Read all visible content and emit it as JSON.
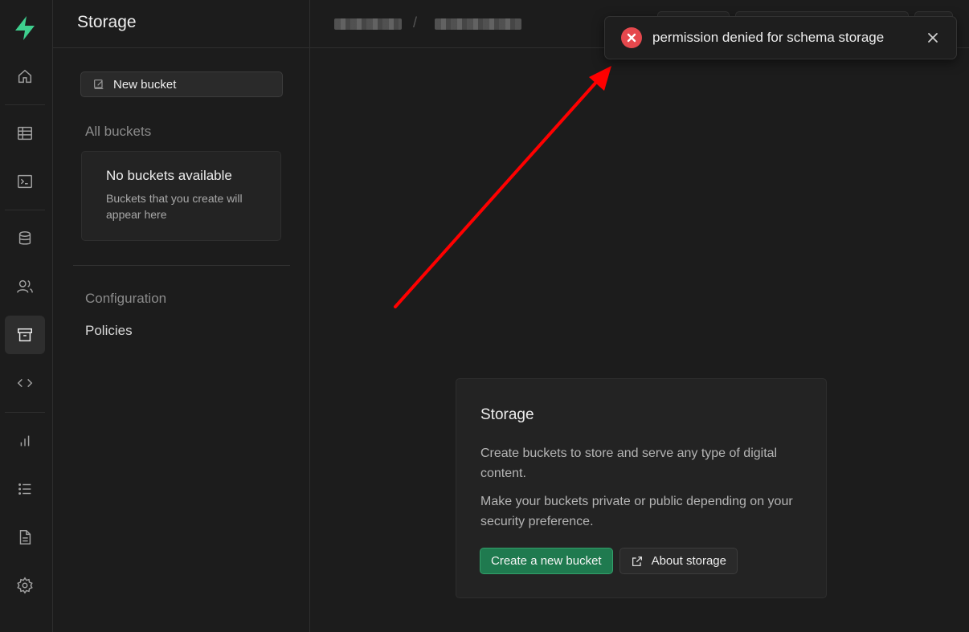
{
  "sidebar": {
    "title": "Storage",
    "new_bucket_label": "New bucket",
    "all_buckets_label": "All buckets",
    "empty_title": "No buckets available",
    "empty_text": "Buckets that you create will appear here",
    "configuration_label": "Configuration",
    "policies_label": "Policies"
  },
  "rail": {
    "items": [
      "home-icon",
      "table-editor-icon",
      "sql-editor-icon",
      "database-icon",
      "auth-icon",
      "storage-icon",
      "edge-functions-icon",
      "reports-icon",
      "logs-icon",
      "api-docs-icon",
      "settings-icon"
    ],
    "active": "storage-icon"
  },
  "main": {
    "card_title": "Storage",
    "card_text_1": "Create buckets to store and serve any type of digital content.",
    "card_text_2": "Make your buckets private or public depending on your security preference.",
    "primary_button": "Create a new bucket",
    "secondary_button": "About storage"
  },
  "toast": {
    "message": "permission denied for schema storage"
  },
  "colors": {
    "brand": "#3ecf8e",
    "error": "#e5484d",
    "primary_button": "#1f7a4f",
    "annotation_arrow": "#ff0000"
  }
}
